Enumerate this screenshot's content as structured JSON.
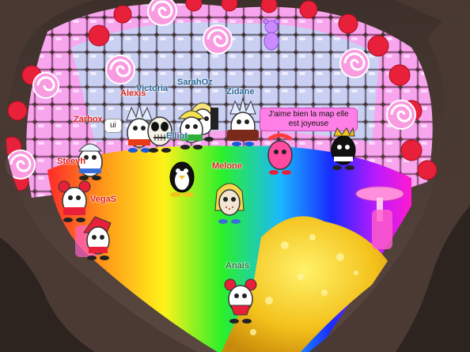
{
  "scene": {
    "type": "game-room",
    "theme": "candy-cave"
  },
  "colors": {
    "cave_wall": "#4a3a33",
    "cube_pink": "#f7a6ee",
    "cube_cyan": "#9ff3f5",
    "candy_red": "#e8203a",
    "gold": "#f4c21c",
    "name_red": "#e0231c",
    "name_blue": "#2a6a9a",
    "name_green": "#1c7a3a"
  },
  "players": [
    {
      "id": "zarbox",
      "name": "Zarbox",
      "name_color": "#e0231c",
      "skin": "white-cap"
    },
    {
      "id": "alexis",
      "name": "Alexis",
      "name_color": "#e0231c",
      "skin": "white-spiky"
    },
    {
      "id": "victoria",
      "name": "Victoria",
      "name_color": "#2a6a9a",
      "skin": "skull"
    },
    {
      "id": "sarahoz",
      "name": "SarahOz",
      "name_color": "#2a6a9a",
      "skin": "blonde"
    },
    {
      "id": "zidane",
      "name": "Zidane",
      "name_color": "#2a6a9a",
      "skin": "white-spiky"
    },
    {
      "id": "elliot",
      "name": "Elliot",
      "name_color": "#2a6a9a",
      "skin": "green-blonde"
    },
    {
      "id": "steevh",
      "name": "Steevh",
      "name_color": "#e0231c",
      "skin": "red-ears"
    },
    {
      "id": "vegas",
      "name": "VegaS",
      "name_color": "#e0231c",
      "skin": "red-hair"
    },
    {
      "id": "penguin",
      "name": "",
      "skin": "penguin"
    },
    {
      "id": "melone",
      "name": "Melone",
      "name_color": "#e0231c",
      "skin": "hockey-mask"
    },
    {
      "id": "pinky",
      "name": "",
      "skin": "pink"
    },
    {
      "id": "dark",
      "name": "",
      "skin": "dark-crown"
    },
    {
      "id": "anais",
      "name": "Anais",
      "name_color": "#1c7a3a",
      "skin": "red-buns"
    }
  ],
  "bubbles": {
    "alexis": "ui",
    "zidane": "J'aime bien la map elle est joyeuse"
  },
  "icons": [
    "lollipop-icon",
    "candy-cube-icon",
    "gold-coin-pile-icon",
    "gummy-bear-icon"
  ]
}
